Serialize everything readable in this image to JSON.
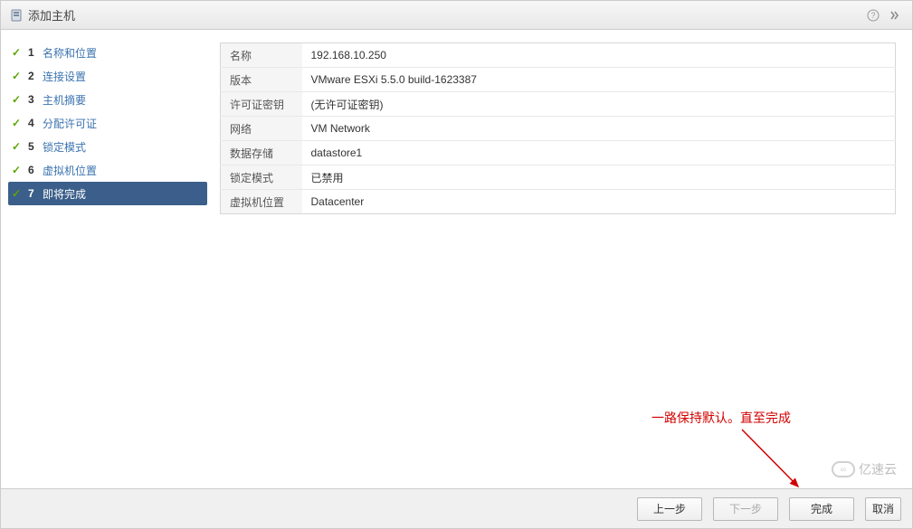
{
  "title": "添加主机",
  "steps": [
    {
      "num": "1",
      "label": "名称和位置",
      "done": true,
      "active": false
    },
    {
      "num": "2",
      "label": "连接设置",
      "done": true,
      "active": false
    },
    {
      "num": "3",
      "label": "主机摘要",
      "done": true,
      "active": false
    },
    {
      "num": "4",
      "label": "分配许可证",
      "done": true,
      "active": false
    },
    {
      "num": "5",
      "label": "锁定模式",
      "done": true,
      "active": false
    },
    {
      "num": "6",
      "label": "虚拟机位置",
      "done": true,
      "active": false
    },
    {
      "num": "7",
      "label": "即将完成",
      "done": true,
      "active": true
    }
  ],
  "summary": {
    "name_key": "名称",
    "name_val": "192.168.10.250",
    "version_key": "版本",
    "version_val": "VMware ESXi 5.5.0 build-1623387",
    "license_key": "许可证密钥",
    "license_val": "(无许可证密钥)",
    "network_key": "网络",
    "network_val": "VM Network",
    "datastore_key": "数据存储",
    "datastore_val": "datastore1",
    "lock_key": "锁定模式",
    "lock_val": "已禁用",
    "vmloc_key": "虚拟机位置",
    "vmloc_val": "Datacenter"
  },
  "buttons": {
    "back": "上一步",
    "next": "下一步",
    "finish": "完成",
    "cancel": "取消"
  },
  "annotation": "一路保持默认。直至完成",
  "watermark": "亿速云"
}
